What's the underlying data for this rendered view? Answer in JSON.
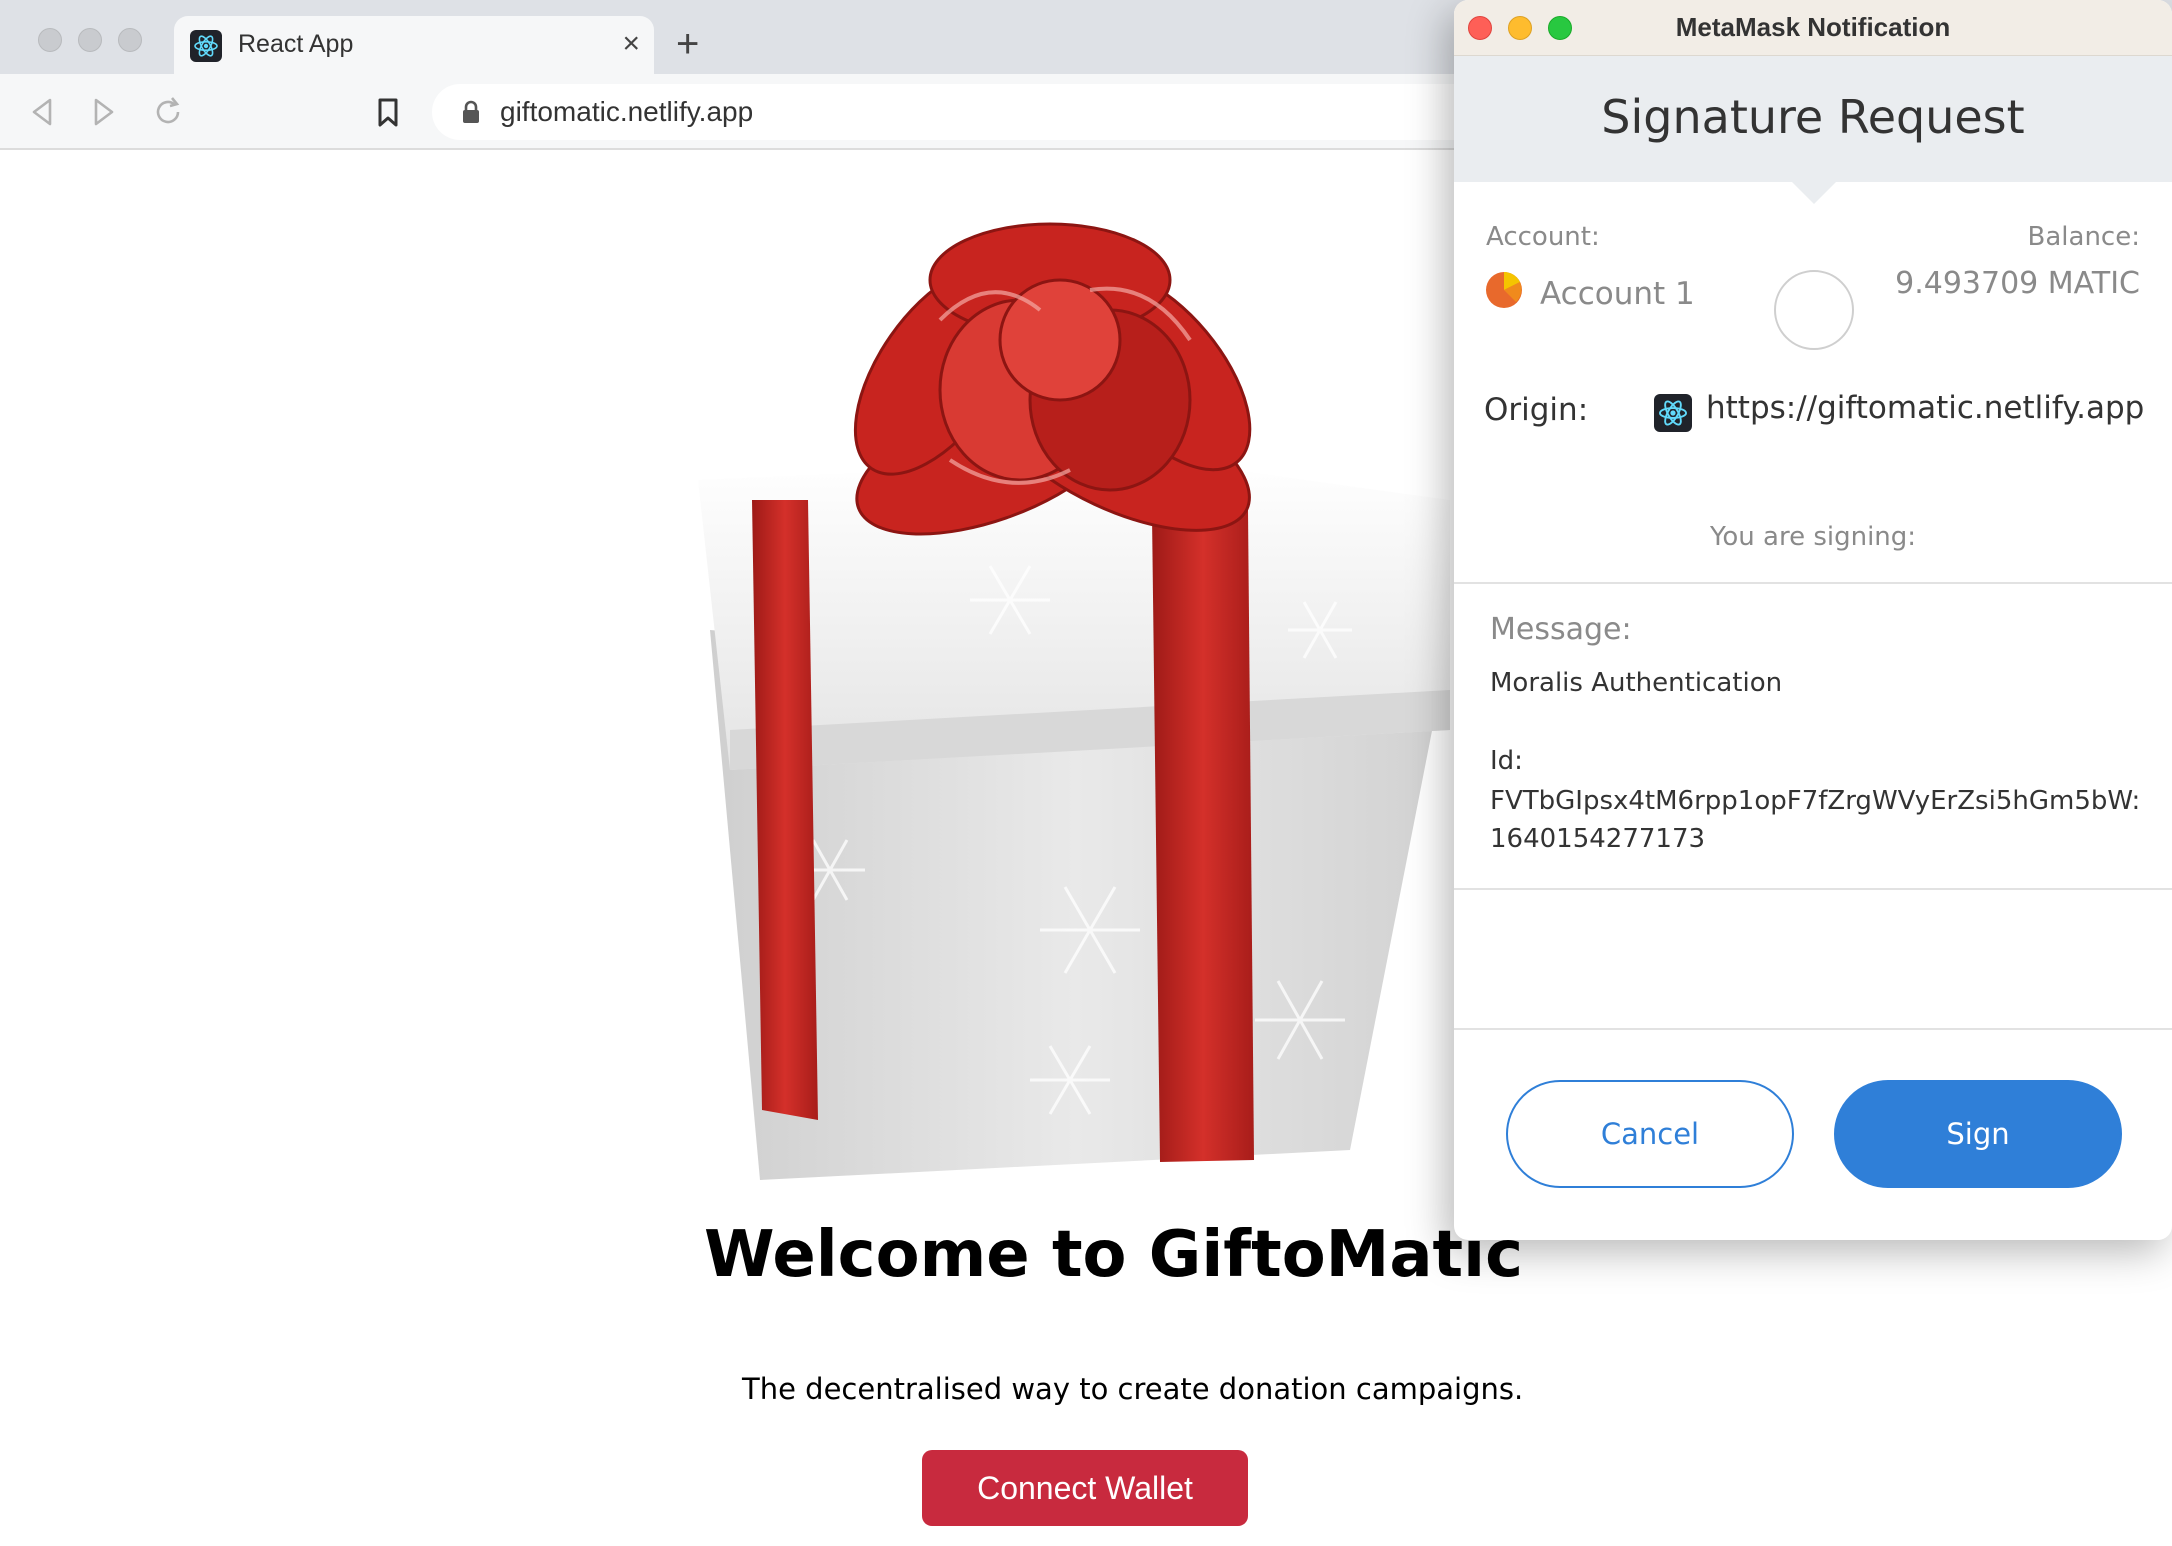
{
  "browser": {
    "tab_title": "React App",
    "tab_close": "×",
    "new_tab": "+",
    "url": "giftomatic.netlify.app"
  },
  "page": {
    "welcome": "Welcome to GiftoMatic",
    "tagline": "The decentralised way to create donation campaigns.",
    "connect_label": "Connect Wallet"
  },
  "metamask": {
    "window_title": "MetaMask Notification",
    "heading": "Signature Request",
    "account_label": "Account:",
    "account_name": "Account 1",
    "balance_label": "Balance:",
    "balance_value": "9.493709 MATIC",
    "origin_label": "Origin:",
    "origin_url": "https://giftomatic.netlify.app",
    "signing_label": "You are signing:",
    "message_label": "Message:",
    "message_title": "Moralis Authentication",
    "message_id_label": "Id:",
    "message_id_value": "FVTbGIpsx4tM6rpp1opF7fZrgWVyErZsi5hGm5bW:",
    "message_id_suffix": "1640154277173",
    "cancel_label": "Cancel",
    "sign_label": "Sign"
  },
  "colors": {
    "connect_button": "#c82a3e",
    "metamask_accent": "#2f7fd8",
    "mac_close": "#fe5f57",
    "mac_minimize": "#febc2e",
    "mac_zoom": "#28c840"
  },
  "icons": [
    "back-icon",
    "forward-icon",
    "reload-icon",
    "bookmark-icon",
    "lock-icon",
    "react-favicon-icon",
    "account-identicon-icon"
  ]
}
